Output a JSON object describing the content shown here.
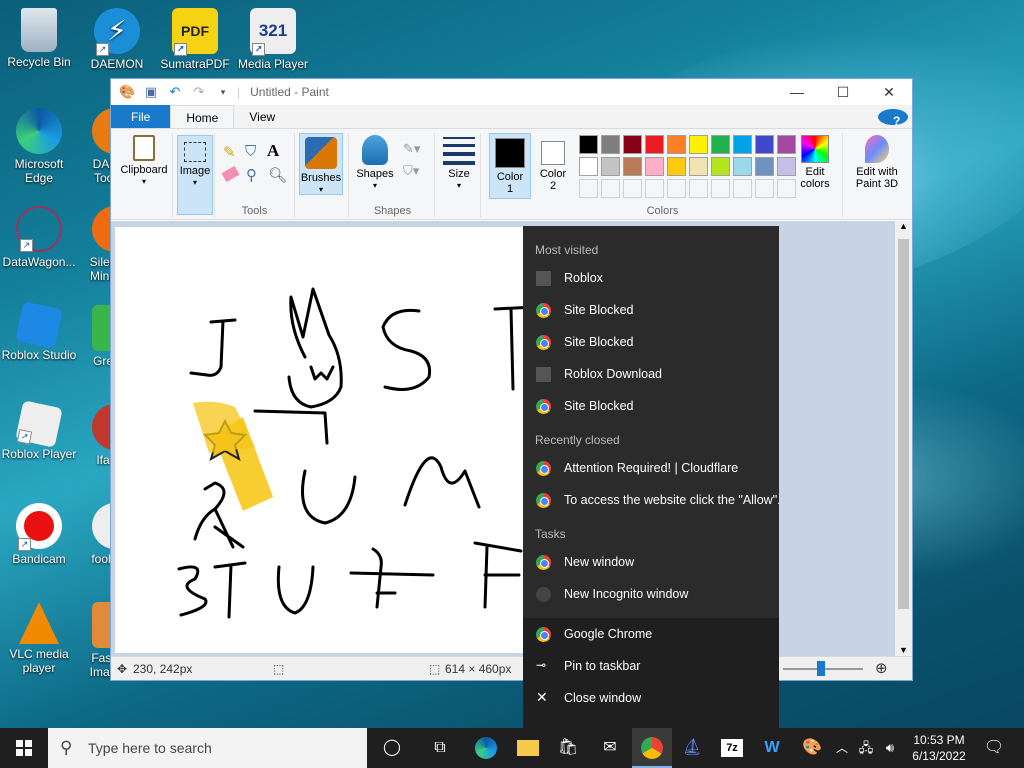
{
  "desktop": {
    "icons": [
      {
        "label": "Recycle Bin"
      },
      {
        "label": "DAEMON Tools"
      },
      {
        "label": "SumatraPDF"
      },
      {
        "label": "Media Player"
      },
      {
        "label": "Microsoft Edge"
      },
      {
        "label": "DAE Tool"
      },
      {
        "label": "DataWagon..."
      },
      {
        "label": "Silen Mine"
      },
      {
        "label": "Roblox Studio"
      },
      {
        "label": "Gre"
      },
      {
        "label": "Roblox Player"
      },
      {
        "label": "Ifa"
      },
      {
        "label": "Bandicam"
      },
      {
        "label": "foob"
      },
      {
        "label": "VLC media player"
      },
      {
        "label": "Fast Imag"
      }
    ]
  },
  "paint": {
    "title": "Untitled - Paint",
    "tabs": [
      "File",
      "Home",
      "View"
    ],
    "help": "?",
    "groups": {
      "clipboard": "Clipboard",
      "image": "Image",
      "tools": "Tools",
      "brushes": "Brushes",
      "shapes": "Shapes",
      "shapes_group": "Shapes",
      "size": "Size",
      "color1": "Color 1",
      "color2": "Color 2",
      "colors": "Colors",
      "edit_colors": "Edit colors",
      "edit_3d": "Edit with Paint 3D"
    },
    "palette_row1": [
      "#000000",
      "#7f7f7f",
      "#880015",
      "#ed1c24",
      "#ff7f27",
      "#fff200",
      "#22b14c",
      "#00a2e8",
      "#3f48cc",
      "#a349a4"
    ],
    "palette_row2": [
      "#ffffff",
      "#c3c3c3",
      "#b97a57",
      "#ffaec9",
      "#ffc90e",
      "#efe4b0",
      "#b5e61d",
      "#99d9ea",
      "#7092be",
      "#c8bfe7"
    ],
    "status": {
      "position": "230, 242px",
      "size": "614 × 460px"
    }
  },
  "jumplist": {
    "most_visited_header": "Most visited",
    "most_visited": [
      "Roblox",
      "Site Blocked",
      "Site Blocked",
      "Roblox Download",
      "Site Blocked"
    ],
    "recently_closed_header": "Recently closed",
    "recently_closed": [
      "Attention Required! | Cloudflare",
      "To access the website click the \"Allow\"..."
    ],
    "tasks_header": "Tasks",
    "tasks": [
      "New window",
      "New Incognito window"
    ],
    "app": "Google Chrome",
    "pin": "Pin to taskbar",
    "close": "Close window"
  },
  "taskbar": {
    "search_placeholder": "Type here to search",
    "time": "10:53 PM",
    "date": "6/13/2022"
  }
}
